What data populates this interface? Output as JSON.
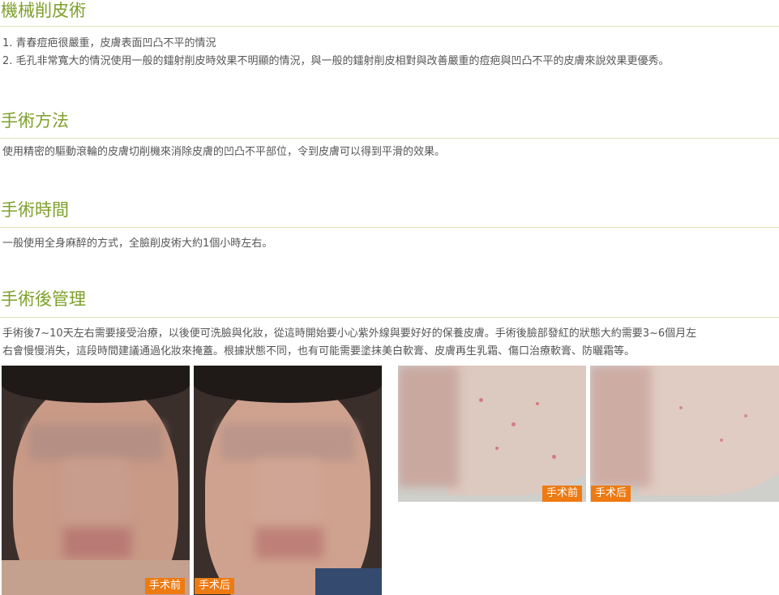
{
  "sections": [
    {
      "title": "機械削皮術",
      "lines": [
        "1. 青春痘疤很嚴重，皮膚表面凹凸不平的情況",
        "2. 毛孔非常寬大的情況使用一般的鐳射削皮時效果不明顯的情況，與一般的鐳射削皮相對與改善嚴重的痘疤與凹凸不平的皮膚來說效果更優秀。"
      ]
    },
    {
      "title": "手術方法",
      "lines": [
        "使用精密的驅動滾輪的皮膚切削機來消除皮膚的凹凸不平部位，令到皮膚可以得到平滑的效果。"
      ]
    },
    {
      "title": "手術時間",
      "lines": [
        "一般使用全身麻醉的方式，全臉削皮術大約1個小時左右。"
      ]
    },
    {
      "title": "手術後管理",
      "lines": [
        "手術後7~10天左右需要接受治療，以後便可洗臉與化妝，從這時開始要小心紫外線與要好好的保養皮膚。手術後臉部發紅的狀態大約需要3~6個月左",
        "右會慢慢消失，這段時間建議通過化妝來掩蓋。根據狀態不同，也有可能需要塗抹美白軟膏、皮膚再生乳霜、傷口治療軟膏、防曬霜等。"
      ]
    }
  ],
  "photos": {
    "before_label": "手术前",
    "after_label": "手术后"
  },
  "colors": {
    "heading": "#7ea02a",
    "badge": "#ee7a12"
  }
}
